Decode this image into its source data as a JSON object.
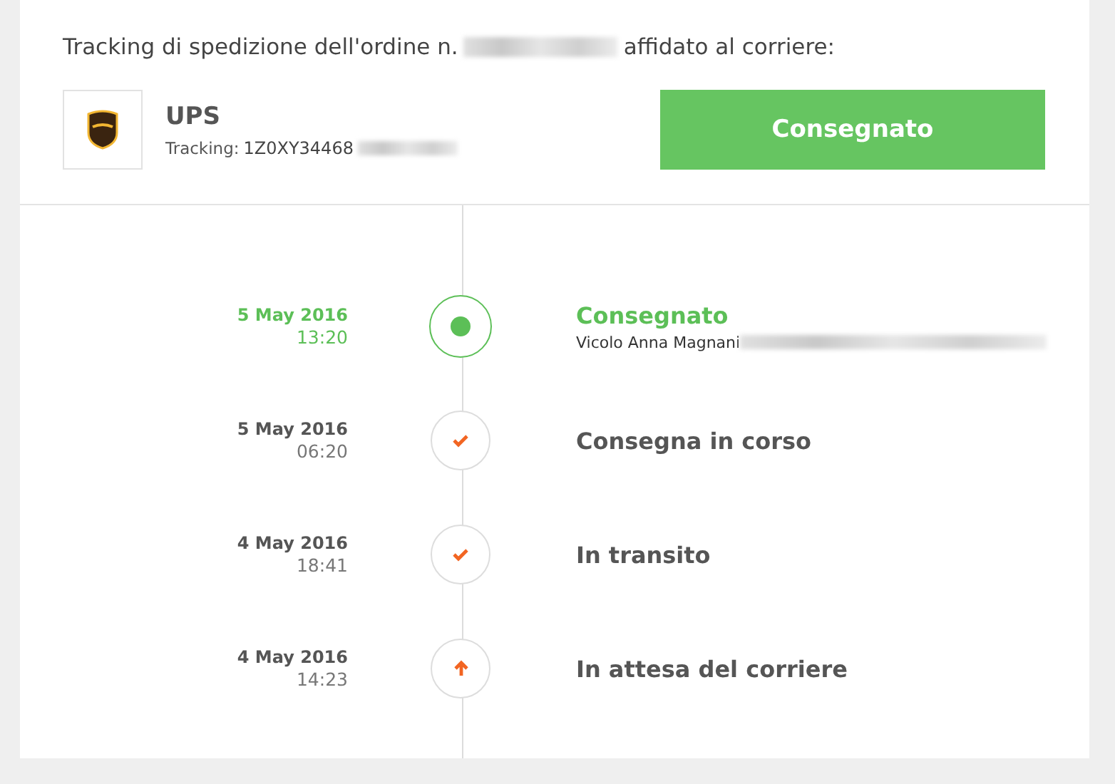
{
  "heading": {
    "before": "Tracking di spedizione dell'ordine n.",
    "after": "affidato al corriere:"
  },
  "carrier": {
    "name": "UPS",
    "tracking_label": "Tracking:",
    "tracking_number": "1Z0XY34468"
  },
  "status_button": {
    "label": "Consegnato"
  },
  "events": [
    {
      "kind": "current",
      "date": "5 May 2016",
      "time": "13:20",
      "title": "Consegnato",
      "address": "Vicolo Anna Magnani"
    },
    {
      "kind": "check",
      "date": "5 May 2016",
      "time": "06:20",
      "title": "Consegna in corso"
    },
    {
      "kind": "check",
      "date": "4 May 2016",
      "time": "18:41",
      "title": "In transito"
    },
    {
      "kind": "pickup",
      "date": "4 May 2016",
      "time": "14:23",
      "title": "In attesa del corriere"
    }
  ]
}
